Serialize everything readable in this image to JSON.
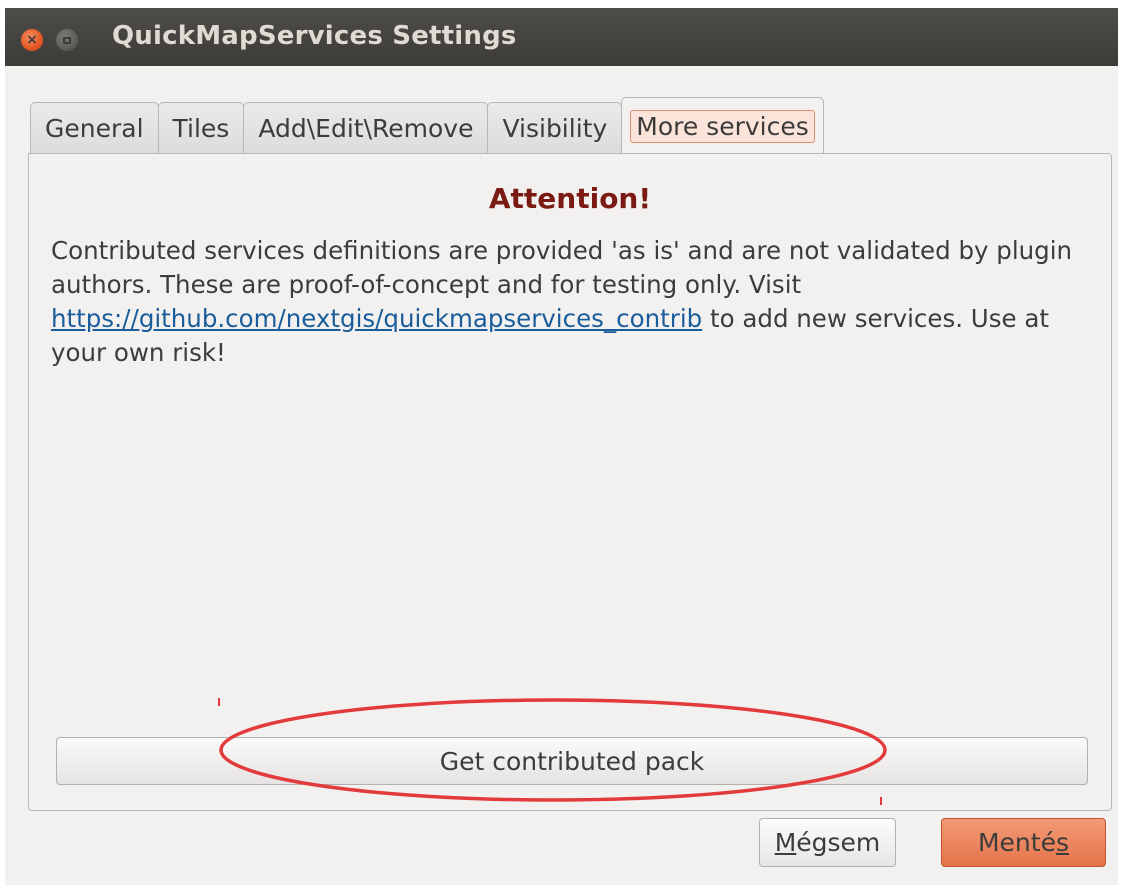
{
  "window": {
    "title": "QuickMapServices Settings"
  },
  "tabs": [
    {
      "label": "General",
      "active": false
    },
    {
      "label": "Tiles",
      "active": false
    },
    {
      "label": "Add\\Edit\\Remove",
      "active": false
    },
    {
      "label": "Visibility",
      "active": false
    },
    {
      "label": "More services",
      "active": true
    }
  ],
  "more_services": {
    "heading": "Attention!",
    "text_before_link": "Contributed services definitions are provided 'as is' and are not validated by plugin authors. These are proof-of-concept and for testing only. Visit ",
    "link_text": "https://github.com/nextgis/quickmapservices_contrib",
    "text_after_link": " to add new services. Use at your own risk!",
    "get_pack_button": "Get contributed pack"
  },
  "dialog_buttons": {
    "cancel_prefix": "",
    "cancel_mnemonic": "M",
    "cancel_rest": "égsem",
    "save_prefix": "Menté",
    "save_mnemonic": "s",
    "save_rest": ""
  },
  "colors": {
    "accent": "#e5734a",
    "heading": "#7a1a12",
    "link": "#1b5d9b",
    "annotation": "#e33b3b"
  }
}
